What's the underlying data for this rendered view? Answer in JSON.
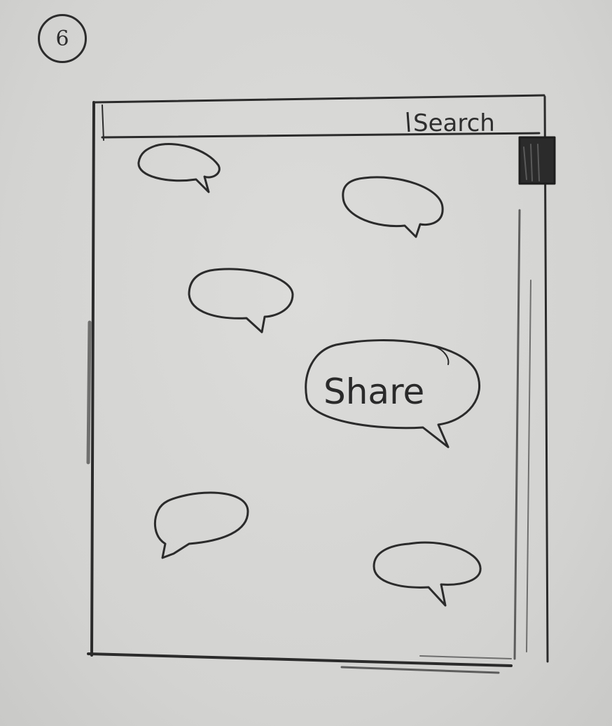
{
  "page_number": "6",
  "header": {
    "search_label": "Search"
  },
  "main": {
    "share_bubble_label": "Share"
  },
  "colors": {
    "paper": "#d6d6d4",
    "pencil": "#2c2c2c"
  }
}
